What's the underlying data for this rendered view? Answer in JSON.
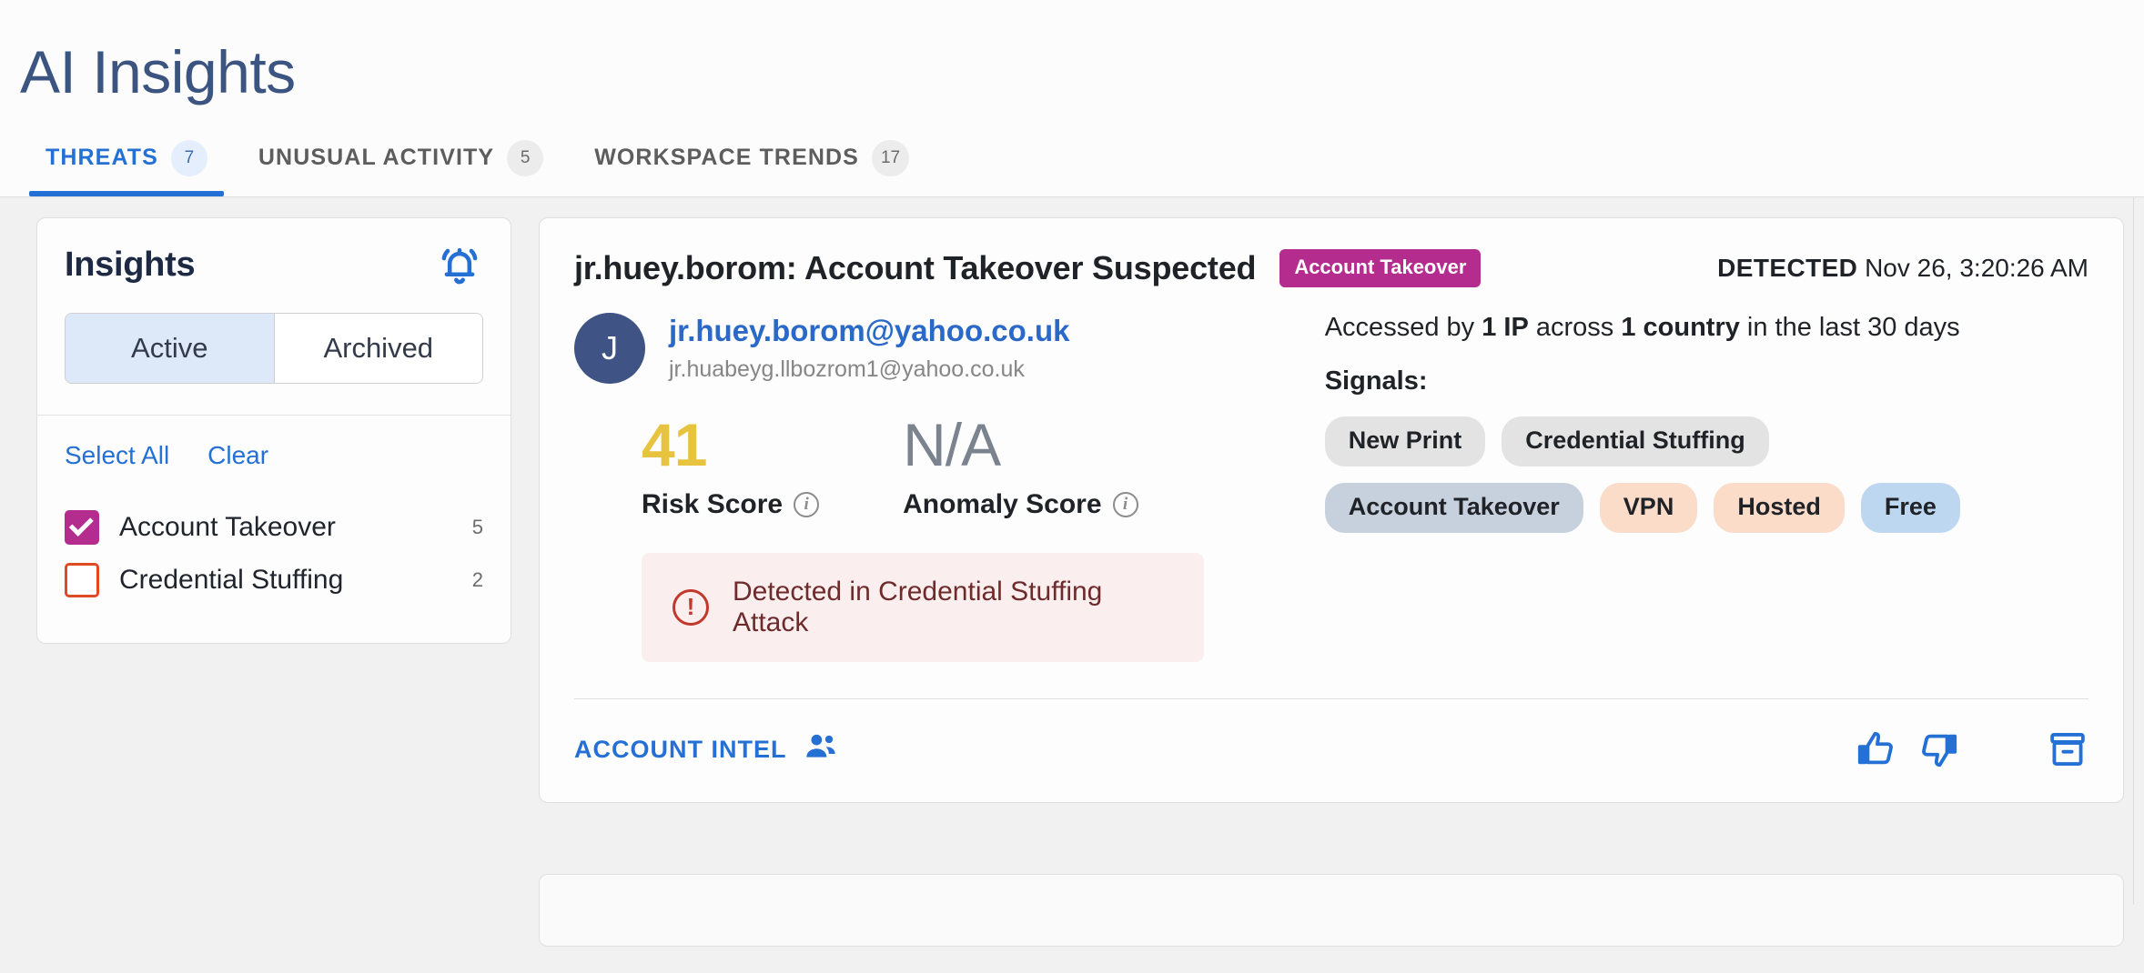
{
  "header": {
    "title": "AI Insights",
    "tabs": [
      {
        "label": "THREATS",
        "badge": "7",
        "active": true
      },
      {
        "label": "UNUSUAL ACTIVITY",
        "badge": "5",
        "active": false
      },
      {
        "label": "WORKSPACE TRENDS",
        "badge": "17",
        "active": false
      }
    ]
  },
  "sidebar": {
    "title": "Insights",
    "bell_icon": "bell-ringing-icon",
    "segments": [
      {
        "label": "Active",
        "active": true
      },
      {
        "label": "Archived",
        "active": false
      }
    ],
    "select_all_label": "Select All",
    "clear_label": "Clear",
    "filters": [
      {
        "label": "Account Takeover",
        "count": "5",
        "checked": true,
        "color": "#b52c8f"
      },
      {
        "label": "Credential Stuffing",
        "count": "2",
        "checked": false,
        "color": "#e04a22"
      }
    ]
  },
  "threat": {
    "title": "jr.huey.borom: Account Takeover Suspected",
    "category_pill": "Account Takeover",
    "category_color": "#b52c8f",
    "detected_label": "DETECTED",
    "detected_time": "Nov 26, 3:20:26 AM",
    "avatar_initial": "J",
    "email": "jr.huey.borom@yahoo.co.uk",
    "alias": "jr.huabeyg.llbozrom1@yahoo.co.uk",
    "scores": [
      {
        "value": "41",
        "label": "Risk Score",
        "color": "#e8c33f",
        "info_icon": "info-icon"
      },
      {
        "value": "N/A",
        "label": "Anomaly Score",
        "color": "#7a838e",
        "info_icon": "info-icon"
      }
    ],
    "alert": {
      "icon": "alert-exclamation-icon",
      "text": "Detected in Credential Stuffing Attack"
    },
    "access_prefix": "Accessed by ",
    "access_ip": "1 IP",
    "access_mid": " across ",
    "access_country": "1 country",
    "access_suffix": " in the last 30 days",
    "signals_label": "Signals:",
    "signals": [
      {
        "label": "New Print",
        "style": "gray"
      },
      {
        "label": "Credential Stuffing",
        "style": "gray"
      },
      {
        "label": "Account Takeover",
        "style": "bluegray"
      },
      {
        "label": "VPN",
        "style": "peach"
      },
      {
        "label": "Hosted",
        "style": "peach"
      },
      {
        "label": "Free",
        "style": "blue"
      }
    ],
    "footer": {
      "account_intel_label": "ACCOUNT INTEL",
      "people_icon": "people-icon",
      "thumb_up_icon": "thumb-up-icon",
      "thumb_down_icon": "thumb-down-icon",
      "archive_icon": "archive-icon"
    }
  }
}
